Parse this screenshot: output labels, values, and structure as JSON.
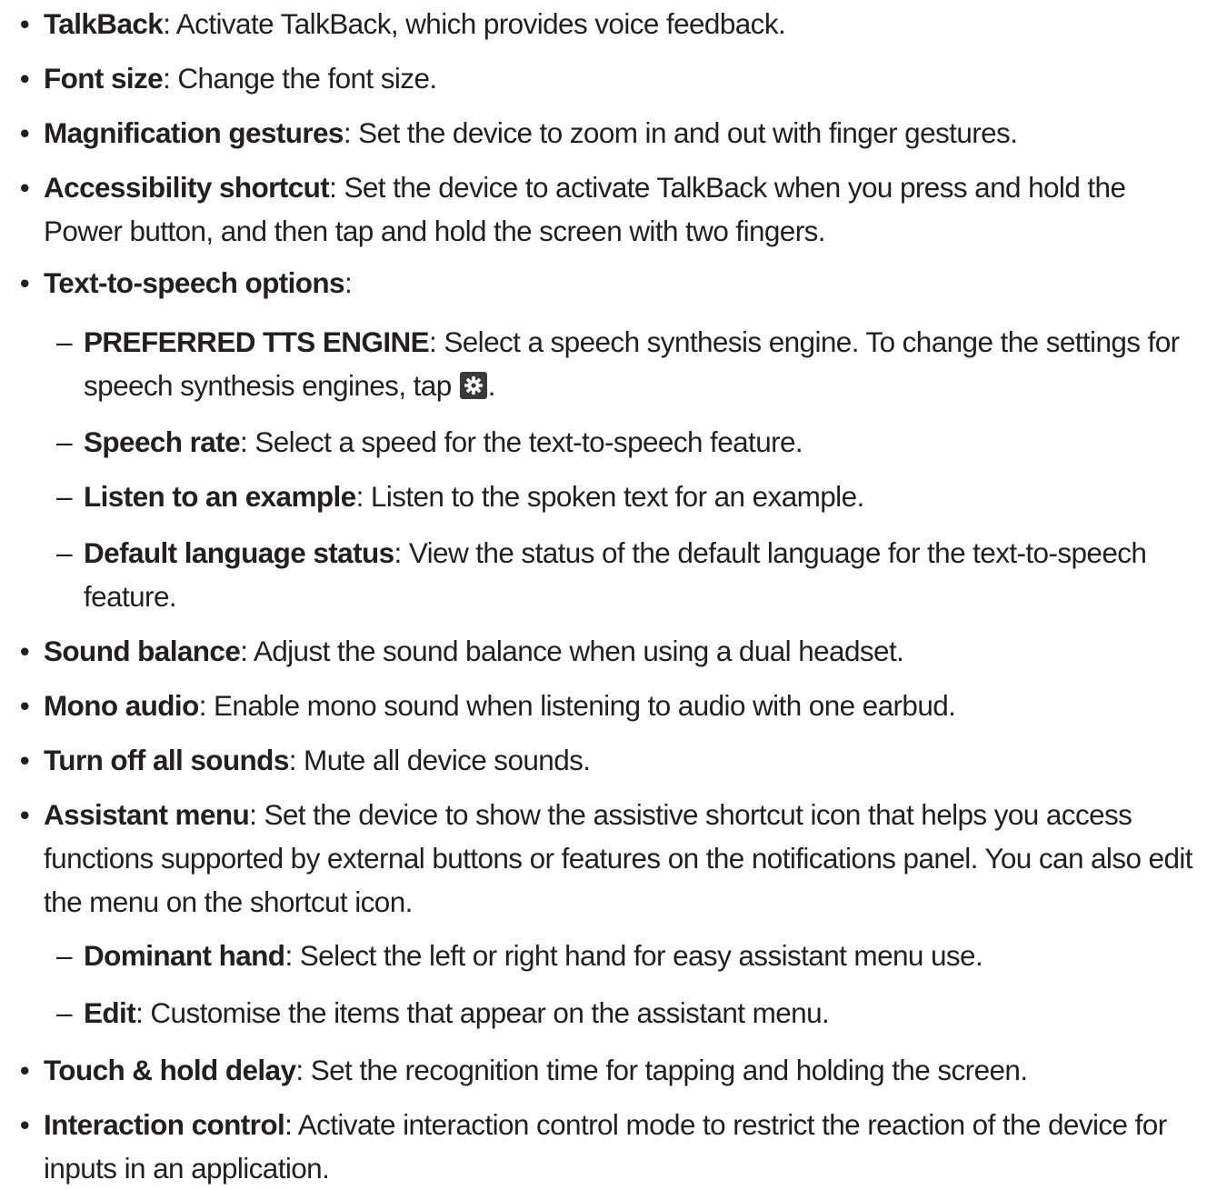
{
  "bullet_glyph": "•",
  "dash_glyph": "–",
  "items": [
    {
      "term": "TalkBack",
      "text": ": Activate TalkBack, which provides voice feedback."
    },
    {
      "term": "Font size",
      "text": ": Change the font size."
    },
    {
      "term": "Magnification gestures",
      "text": ": Set the device to zoom in and out with finger gestures."
    },
    {
      "term": "Accessibility shortcut",
      "text": ": Set the device to activate TalkBack when you press and hold the Power button, and then tap and hold the screen with two fingers."
    },
    {
      "term": "Text-to-speech options",
      "text": ":"
    },
    {
      "term": "PREFERRED TTS ENGINE",
      "text": ": Select a speech synthesis engine. To change the settings for speech synthesis engines, tap ",
      "text_after_icon": "."
    },
    {
      "term": "Speech rate",
      "text": ": Select a speed for the text-to-speech feature."
    },
    {
      "term": "Listen to an example",
      "text": ": Listen to the spoken text for an example."
    },
    {
      "term": "Default language status",
      "text": ": View the status of the default language for the text-to-speech feature."
    },
    {
      "term": "Sound balance",
      "text": ": Adjust the sound balance when using a dual headset."
    },
    {
      "term": "Mono audio",
      "text": ": Enable mono sound when listening to audio with one earbud."
    },
    {
      "term": "Turn off all sounds",
      "text": ": Mute all device sounds."
    },
    {
      "term": "Assistant menu",
      "text": ": Set the device to show the assistive shortcut icon that helps you access functions supported by external buttons or features on the notifications panel. You can also edit the menu on the shortcut icon."
    },
    {
      "term": "Dominant hand",
      "text": ": Select the left or right hand for easy assistant menu use."
    },
    {
      "term": "Edit",
      "text": ": Customise the items that appear on the assistant menu."
    },
    {
      "term": "Touch & hold delay",
      "text": ": Set the recognition time for tapping and holding the screen."
    },
    {
      "term": "Interaction control",
      "text": ": Activate interaction control mode to restrict the reaction of the device for inputs in an application."
    }
  ]
}
